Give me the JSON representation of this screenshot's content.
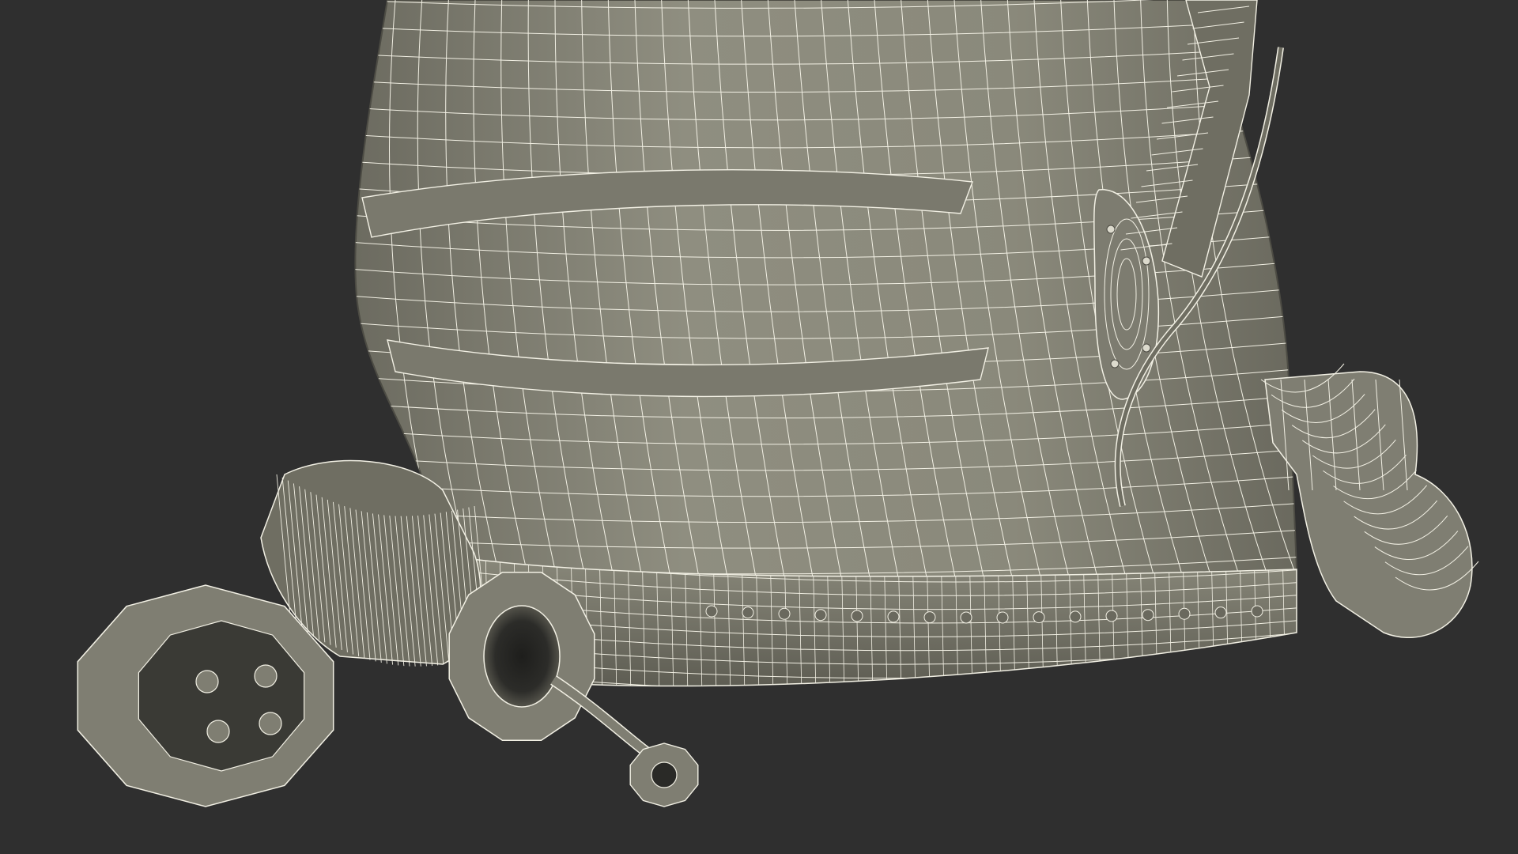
{
  "scene": {
    "subject_icon": "wireframe-helmet-render",
    "background_color": "#2f2f2f",
    "shell_color": "#8d8c7e",
    "shell_shade_color": "#6f6e62",
    "shell_dark_color": "#4f4e45",
    "wire_color": "#f2f0e4"
  }
}
